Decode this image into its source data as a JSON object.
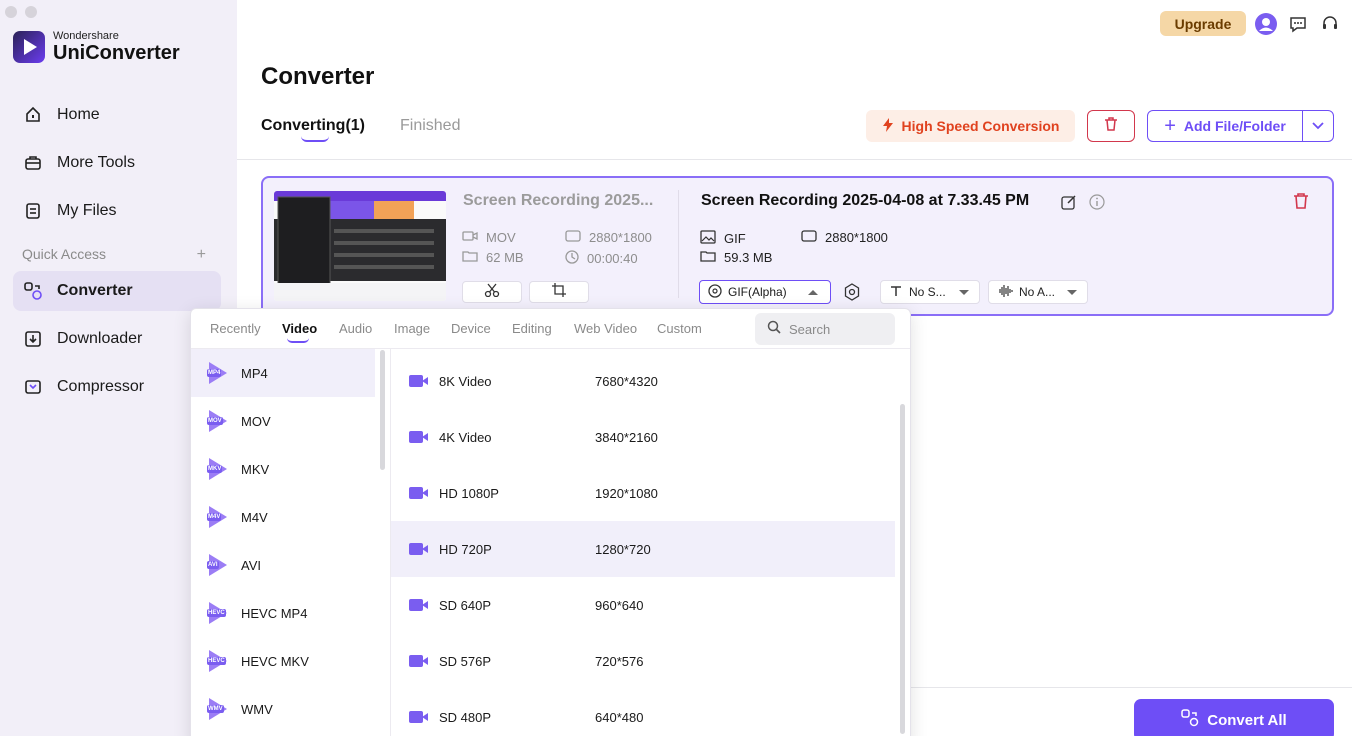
{
  "app": {
    "brand": "Wondershare",
    "product": "UniConverter"
  },
  "sidebar": {
    "items": [
      {
        "label": "Home",
        "icon": "home-icon"
      },
      {
        "label": "More Tools",
        "icon": "toolbox-icon"
      },
      {
        "label": "My Files",
        "icon": "files-icon"
      },
      {
        "label": "Converter",
        "icon": "converter-icon",
        "active": true
      },
      {
        "label": "Downloader",
        "icon": "downloader-icon"
      },
      {
        "label": "Compressor",
        "icon": "compressor-icon"
      }
    ],
    "quick_access": "Quick Access"
  },
  "header": {
    "upgrade_label": "Upgrade",
    "page_title": "Converter"
  },
  "tabs": [
    {
      "label": "Converting(1)",
      "active": true
    },
    {
      "label": "Finished",
      "active": false
    }
  ],
  "toolbar": {
    "high_speed_label": "High Speed Conversion",
    "add_label": "Add File/Folder"
  },
  "file": {
    "source_name": "Screen Recording 2025...",
    "source_format": "MOV",
    "source_size": "62 MB",
    "source_resolution": "2880*1800",
    "source_duration": "00:00:40",
    "output_name": "Screen Recording 2025-04-08 at 7.33.45 PM",
    "output_format": "GIF",
    "output_size": "59.3 MB",
    "output_resolution": "2880*1800",
    "format_select": "GIF(Alpha)",
    "subtitle_select": "No S...",
    "audio_select": "No A..."
  },
  "panel": {
    "tabs": [
      "Recently",
      "Video",
      "Audio",
      "Image",
      "Device",
      "Editing",
      "Web Video",
      "Custom"
    ],
    "active_tab": "Video",
    "search_placeholder": "Search",
    "formats": [
      {
        "label": "MP4",
        "badge": "MP4"
      },
      {
        "label": "MOV",
        "badge": "MOV"
      },
      {
        "label": "MKV",
        "badge": "MKV"
      },
      {
        "label": "M4V",
        "badge": "M4V"
      },
      {
        "label": "AVI",
        "badge": "AVI"
      },
      {
        "label": "HEVC MP4",
        "badge": "HEVC"
      },
      {
        "label": "HEVC MKV",
        "badge": "HEVC"
      },
      {
        "label": "WMV",
        "badge": "WMV"
      }
    ],
    "resolutions": [
      {
        "name": "8K Video",
        "res": "7680*4320"
      },
      {
        "name": "4K Video",
        "res": "3840*2160"
      },
      {
        "name": "HD 1080P",
        "res": "1920*1080"
      },
      {
        "name": "HD 720P",
        "res": "1280*720"
      },
      {
        "name": "SD 640P",
        "res": "960*640"
      },
      {
        "name": "SD 576P",
        "res": "720*576"
      },
      {
        "name": "SD 480P",
        "res": "640*480"
      }
    ]
  },
  "footer": {
    "convert_all_label": "Convert All"
  },
  "colors": {
    "accent": "#6e4ef6",
    "danger": "#d2374c",
    "upgrade_bg": "#f5d7a6"
  }
}
